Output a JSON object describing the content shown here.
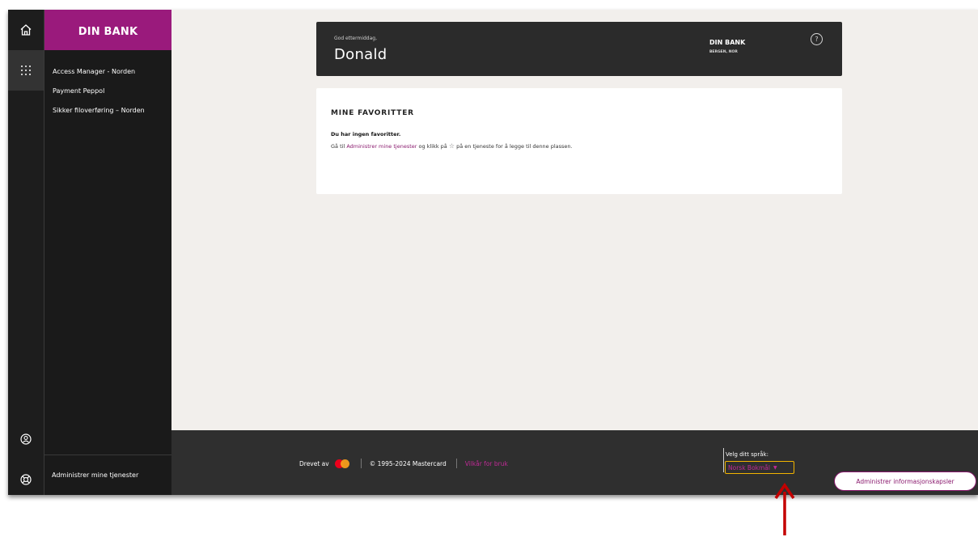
{
  "sidebar": {
    "brand": "DIN BANK",
    "items": [
      {
        "label": "Access Manager - Norden"
      },
      {
        "label": "Payment Peppol"
      },
      {
        "label": "Sikker filoverføring – Norden"
      }
    ],
    "footer_link": "Administrer mine tjenester"
  },
  "rail": {
    "icons": [
      "home-icon",
      "apps-grid-icon",
      "user-circle-icon",
      "lifebuoy-icon"
    ]
  },
  "welcome": {
    "greeting": "God ettermiddag,",
    "name": "Donald",
    "bank_name": "DIN BANK",
    "bank_location": "BERGEN, NOR",
    "help_glyph": "?"
  },
  "favorites": {
    "title": "MINE FAVORITTER",
    "empty_text": "Du har ingen favoritter.",
    "hint_prefix": "Gå til ",
    "hint_link": "Administrer mine tjenester",
    "hint_middle": " og klikk på ",
    "hint_suffix": " på en tjeneste for å legge til denne plassen."
  },
  "footer": {
    "powered_by": "Drevet av",
    "copyright": "© 1995-2024 Mastercard",
    "terms": "Vilkår for bruk",
    "language_label": "Velg ditt språk:",
    "language_selected": "Norsk Bokmål"
  },
  "cookie_button": "Administrer informasjonskapsler",
  "colors": {
    "brand": "#9a1a7c",
    "link": "#8a1a6e",
    "focus_outline": "#f2b400",
    "annotation_arrow": "#c40000"
  }
}
